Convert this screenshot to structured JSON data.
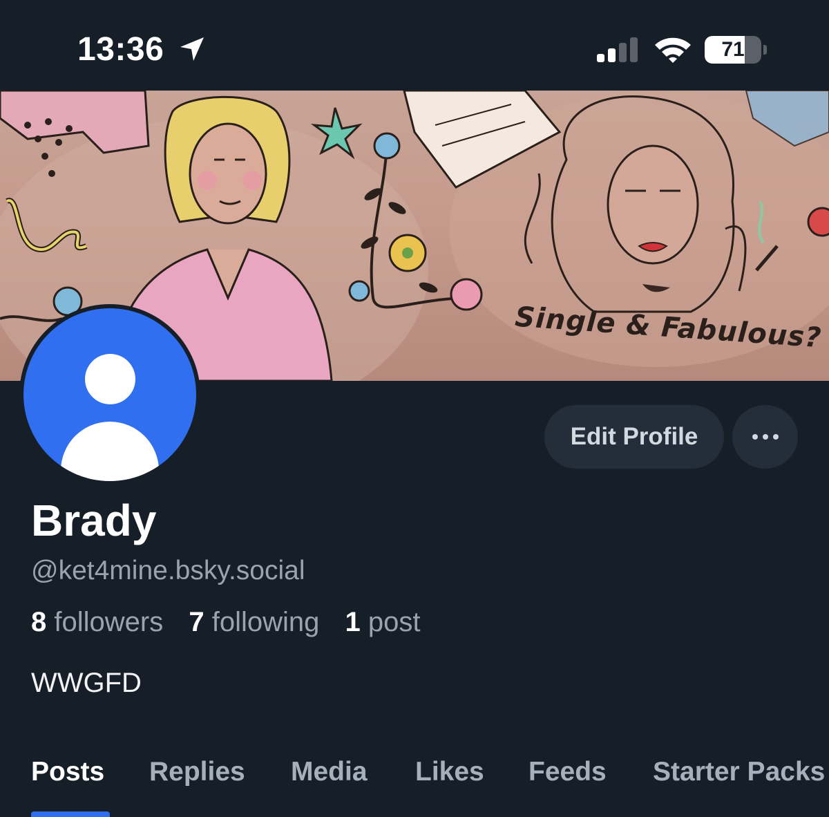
{
  "status_bar": {
    "time": "13:36",
    "battery_level": "71",
    "battery_fraction": 0.71,
    "icons": [
      "location-arrow-icon",
      "cellular-signal-icon",
      "wifi-icon",
      "battery-icon"
    ]
  },
  "banner": {
    "text": "Single & Fabulous?"
  },
  "profile": {
    "display_name": "Brady",
    "handle": "@ket4mine.bsky.social",
    "followers_count": "8",
    "followers_label": "followers",
    "following_count": "7",
    "following_label": "following",
    "posts_count": "1",
    "posts_label": "post",
    "bio": "WWGFD"
  },
  "actions": {
    "edit_profile_label": "Edit Profile",
    "more_icon": "ellipsis-icon"
  },
  "tabs": [
    {
      "label": "Posts",
      "active": true
    },
    {
      "label": "Replies",
      "active": false
    },
    {
      "label": "Media",
      "active": false
    },
    {
      "label": "Likes",
      "active": false
    },
    {
      "label": "Feeds",
      "active": false
    },
    {
      "label": "Starter Packs",
      "active": false
    }
  ],
  "colors": {
    "background": "#161e27",
    "accent": "#2f6ff0",
    "button_background": "#242e3a"
  }
}
